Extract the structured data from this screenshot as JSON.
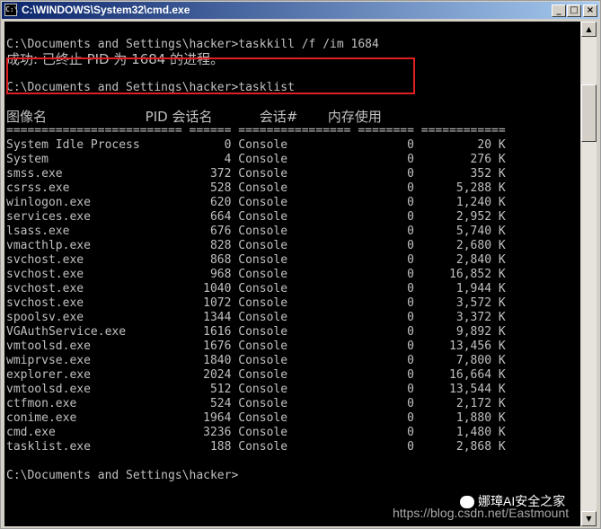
{
  "window": {
    "title": "C:\\WINDOWS\\System32\\cmd.exe",
    "icon": "cmd-icon",
    "buttons": {
      "minimize": "_",
      "maximize": "□",
      "close": "×"
    }
  },
  "console": {
    "fg_color": "#c0c0c0",
    "bg_color": "#000000",
    "highlight_color": "#e02020",
    "lines": [
      "C:\\Documents and Settings\\hacker>taskkill /f /im 1684",
      "成功: 已终止 PID 为 1684 的进程。",
      "",
      "C:\\Documents and Settings\\hacker>tasklist",
      "",
      "图像名                       PID 会话名           会话#       内存使用",
      "========================= ====== ================ ======== ============",
      "System Idle Process            0 Console                 0         20 K",
      "System                         4 Console                 0        276 K",
      "smss.exe                     372 Console                 0        352 K",
      "csrss.exe                    528 Console                 0      5,288 K",
      "winlogon.exe                 620 Console                 0      1,240 K",
      "services.exe                 664 Console                 0      2,952 K",
      "lsass.exe                    676 Console                 0      5,740 K",
      "vmacthlp.exe                 828 Console                 0      2,680 K",
      "svchost.exe                  868 Console                 0      2,840 K",
      "svchost.exe                  968 Console                 0     16,852 K",
      "svchost.exe                 1040 Console                 0      1,944 K",
      "svchost.exe                 1072 Console                 0      3,572 K",
      "spoolsv.exe                 1344 Console                 0      3,372 K",
      "VGAuthService.exe           1616 Console                 0      9,892 K",
      "vmtoolsd.exe                1676 Console                 0     13,456 K",
      "wmiprvse.exe                1840 Console                 0      7,800 K",
      "explorer.exe                2024 Console                 0     16,664 K",
      "vmtoolsd.exe                 512 Console                 0     13,544 K",
      "ctfmon.exe                   524 Console                 0      2,172 K",
      "conime.exe                  1964 Console                 0      1,880 K",
      "cmd.exe                     3236 Console                 0      1,480 K",
      "tasklist.exe                 188 Console                 0      2,868 K",
      "",
      "C:\\Documents and Settings\\hacker>"
    ]
  },
  "watermark": {
    "label": "娜璋AI安全之家",
    "icon": "wechat-icon",
    "url": "https://blog.csdn.net/Eastmount"
  },
  "scrollbar": {
    "up": "▲",
    "down": "▼"
  }
}
